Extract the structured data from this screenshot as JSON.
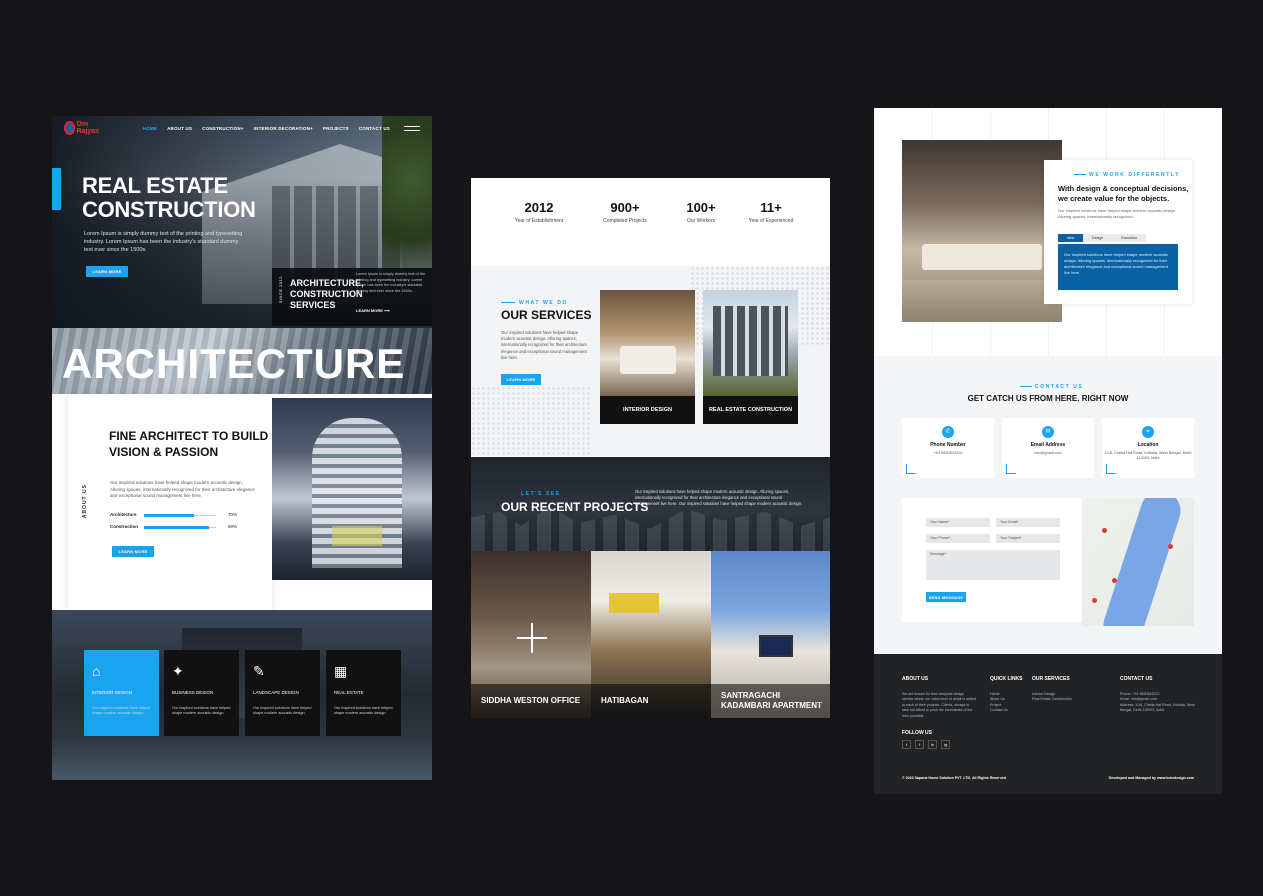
{
  "p1": {
    "logo": "Om Rajyas",
    "nav": [
      "HOME",
      "ABOUT US",
      "CONSTRUCTION+",
      "INTERIOR DECORATION+",
      "PROJECTS",
      "CONTACT US"
    ],
    "hero_title_1": "REAL ESTATE",
    "hero_title_2": "CONSTRUCTION",
    "hero_desc": "Lorem Ipsum is simply dummy text of the printing and typesetting industry. Lorem Ipsum has been the industry's standard dummy text ever since the 1500s.",
    "hero_btn": "LEARN MORE",
    "since": "SINCE 2012",
    "arch_title_1": "ARCHITECTURE,",
    "arch_title_2": "CONSTRUCTION",
    "arch_title_3": "SERVICES",
    "arch_desc": "Lorem Ipsum is simply dummy text of the printing and typesetting industry. Lorem Ipsum has been the industry's standard dummy text ever since the 1500s.",
    "arch_link": "LEARN MORE",
    "band_word": "ARCHITECTURE",
    "about_label": "ABOUT US",
    "about_title_1": "FINE ARCHITECT TO BUILD",
    "about_title_2": "VISION & PASSION",
    "about_desc": "Our inspired solutions have helped shape modern acoustic design. Alluring spaces, internationally recognized for their architecture elegance and exceptional sound management live here.",
    "skills": [
      {
        "label": "Architecture",
        "pct": "70%",
        "value": 0.7
      },
      {
        "label": "Construction",
        "pct": "90%",
        "value": 0.9
      }
    ],
    "about_btn": "LEARN MORE",
    "services": [
      {
        "icon": "⌂",
        "name": "INTERIOR DESIGN",
        "desc": "Our inspired solutions have helped shape modern acoustic design."
      },
      {
        "icon": "✦",
        "name": "BUSINESS DESIGN",
        "desc": "Our inspired solutions have helped shape modern acoustic design."
      },
      {
        "icon": "✎",
        "name": "LANDSCAPE DESIGN",
        "desc": "Our inspired solutions have helped shape modern acoustic design."
      },
      {
        "icon": "▦",
        "name": "REAL ESTATE",
        "desc": "Our inspired solutions have helped shape modern acoustic design."
      }
    ]
  },
  "p2": {
    "stats": [
      {
        "value": "2012",
        "label": "Year of Establishment"
      },
      {
        "value": "900+",
        "label": "Completed Projects"
      },
      {
        "value": "100+",
        "label": "Our Workers"
      },
      {
        "value": "11+",
        "label": "Year of Experienced"
      }
    ],
    "svc_eyebrow": "WHAT WE DO",
    "svc_title": "OUR SERVICES",
    "svc_desc": "Our inspired solutions have helped shape modern acoustic design. Alluring spaces, internationally recognized for their architecture elegance and exceptional sound management live here.",
    "svc_btn": "LEARN MORE",
    "cards": [
      "INTERIOR DESIGN",
      "REAL ESTATE CONSTRUCTION"
    ],
    "proj_eyebrow": "LET'S SEE",
    "proj_title": "OUR RECENT PROJECTS",
    "proj_desc": "Our inspired solutions have helped shape modern acoustic design. Alluring spaces, internationally recognized for their architecture elegance and exceptional sound management live here. Our inspired solutions have helped shape modern acoustic design.",
    "gallery": [
      "SIDDHA WESTON OFFICE",
      "HATIBAGAN",
      "SANTRAGACHI KADAMBARI APARTMENT"
    ]
  },
  "p3": {
    "eyebrow": "WE WORK DIFFERENTLY",
    "title": "With design & conceptual decisions, we create value for the objects.",
    "desc": "Our inspired solutions have helped shape modern acoustic design. Alluring spaces, internationally recognized.",
    "tabs": [
      "Idea",
      "Design",
      "Execution"
    ],
    "tab_text": "Our inspired solutions have helped shape modern acoustic design. Alluring spaces, internationally recognized for their architecture elegance and exceptional sound management live here.",
    "contact_eyebrow": "CONTACT US",
    "contact_title": "GET CATCH US FROM HERE. RIGHT NOW",
    "info": [
      {
        "icon": "✆",
        "title": "Phone Number",
        "detail": "+91 9830543210"
      },
      {
        "icon": "✉",
        "title": "Email Address",
        "detail": "info@gmail.com"
      },
      {
        "icon": "⌖",
        "title": "Location",
        "detail": "1/18, Chetla Hat Road, Kolkata, West Bengal, Delhi 110003, India"
      }
    ],
    "fields": {
      "name": "Your Name*",
      "email": "Your Email*",
      "phone": "Your Phone*",
      "subject": "Your Subject*",
      "message": "Message*"
    },
    "send_btn": "SEND MESSAGE",
    "footer": {
      "about_title": "ABOUT US",
      "about_text": "We are known for their bespoke design service where our extra level of detail is added to each of their projects. Clients, always to take not afford to push the boundaries of the form possible.",
      "quick_title": "QUICK LINKS",
      "quick_links": "Home\nAbout Us\nProject\nContact Us",
      "services_title": "OUR SERVICES",
      "services_text": "Interior Design\nReal Estate Construction",
      "contact_title": "CONTACT US",
      "contact_text": "Phone: +91 9830543210\nEmail: info@gmail.com\nAddress: 1/18, Chetla Hat Road, Kolkata, West Bengal, Delhi 110003, India",
      "follow": "FOLLOW US",
      "social": [
        "t",
        "f",
        "in",
        "ig"
      ],
      "copyright": "© 2023 Sapana Home Solution PVT. LTD. All Rights Reserved",
      "developer": "Developed and Managed by www.kubrdesign.com"
    }
  },
  "colors": {
    "accent": "#1aa3ee",
    "dark": "#111111",
    "tab_blue": "#0a62a5"
  }
}
